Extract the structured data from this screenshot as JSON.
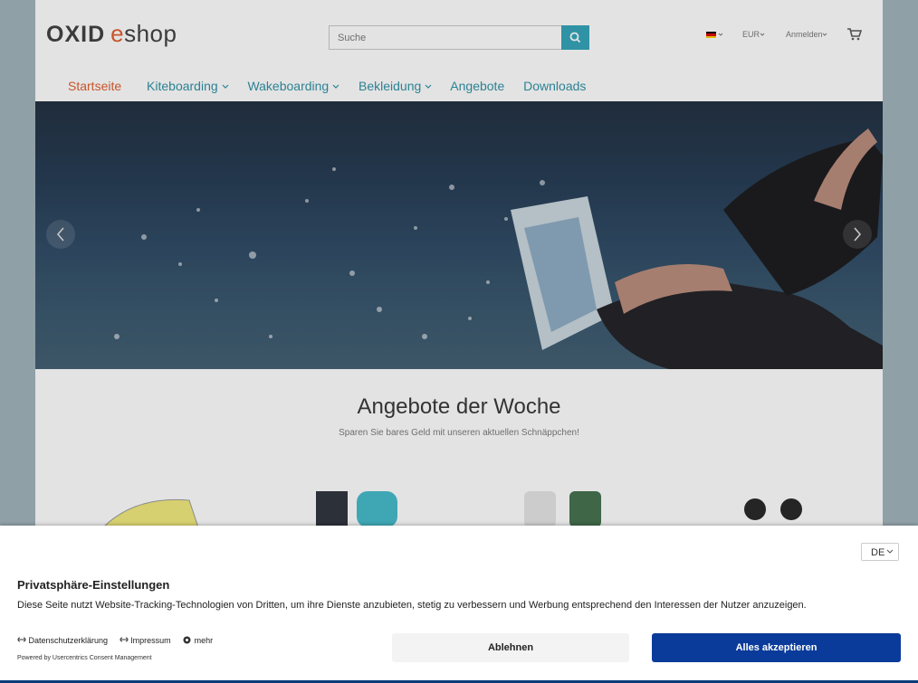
{
  "header": {
    "logo_oxid": "OXID",
    "logo_e": "e",
    "logo_shop": "shop",
    "search_placeholder": "Suche",
    "currency": "EUR",
    "login": "Anmelden"
  },
  "nav": {
    "items": [
      "Startseite",
      "Kiteboarding",
      "Wakeboarding",
      "Bekleidung",
      "Angebote",
      "Downloads"
    ]
  },
  "content": {
    "title": "Angebote der Woche",
    "subtitle": "Sparen Sie bares Geld mit unseren aktuellen Schnäppchen!"
  },
  "consent": {
    "language": "DE",
    "title": "Privatsphäre-Einstellungen",
    "text": "Diese Seite nutzt Website-Tracking-Technologien von Dritten, um ihre Dienste anzubieten, stetig zu verbessern und Werbung entsprechend den Interessen der Nutzer anzuzeigen.",
    "link_privacy": "Datenschutzerklärung",
    "link_imprint": "Impressum",
    "link_more": "mehr",
    "powered": "Powered by Usercentrics Consent Management",
    "deny_label": "Ablehnen",
    "accept_label": "Alles akzeptieren"
  },
  "colors": {
    "accent": "#2ea2b7",
    "brand_orange": "#e05a2b",
    "accept_blue": "#0b3b9a"
  }
}
